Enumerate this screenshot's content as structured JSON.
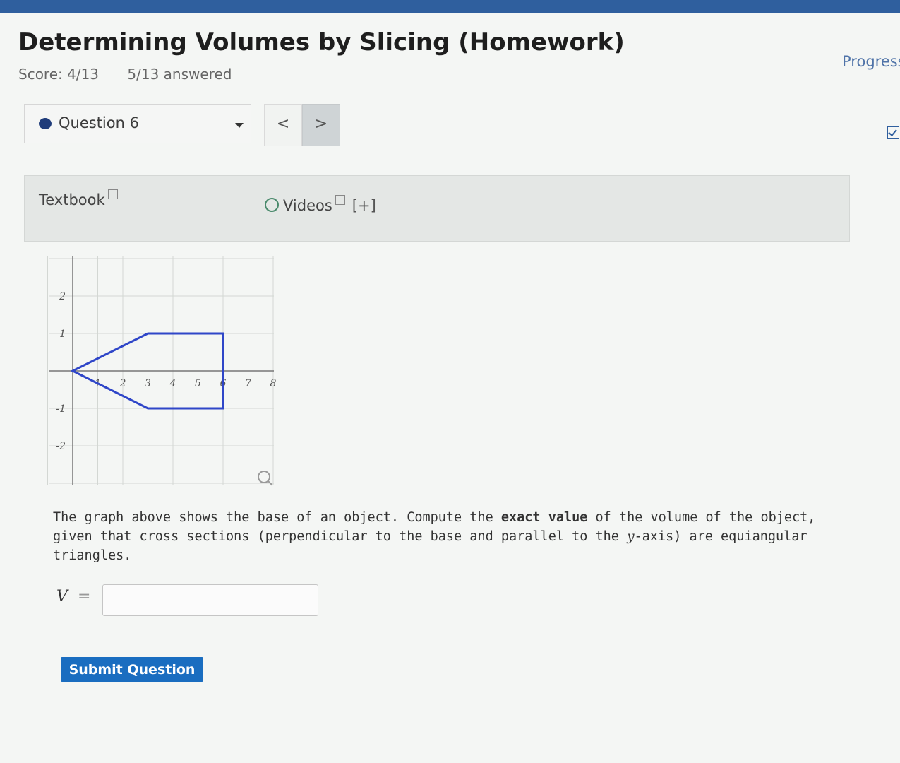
{
  "header": {
    "title": "Determining Volumes by Slicing (Homework)",
    "score": "Score: 4/13",
    "answered": "5/13 answered",
    "progress_label": "Progress"
  },
  "question_nav": {
    "current_question": "Question 6",
    "prev_label": "<",
    "next_label": ">"
  },
  "resources": {
    "textbook_label": "Textbook",
    "videos_label": "Videos",
    "expand_label": "[+]"
  },
  "graph": {
    "x_ticks": [
      "1",
      "2",
      "3",
      "4",
      "5",
      "6",
      "7",
      "8"
    ],
    "y_ticks": [
      "2",
      "1",
      "-1",
      "-2"
    ],
    "polygon_vertices": [
      [
        0,
        0
      ],
      [
        3,
        1
      ],
      [
        6,
        1
      ],
      [
        6,
        -1
      ],
      [
        3,
        -1
      ]
    ],
    "outline_color": "#2f46c8",
    "x_range": [
      -1,
      8
    ],
    "y_range": [
      -3,
      3
    ]
  },
  "question": {
    "text_part1": "The graph above shows the base of an object. Compute the ",
    "text_bold": "exact value",
    "text_part2": " of the volume of the object, given that cross sections (perpendicular to the base and parallel to the ",
    "text_var": "y",
    "text_part3": "-axis) are equiangular triangles."
  },
  "answer": {
    "label": "V",
    "equals": "=",
    "value": ""
  },
  "submit_label": "Submit Question"
}
